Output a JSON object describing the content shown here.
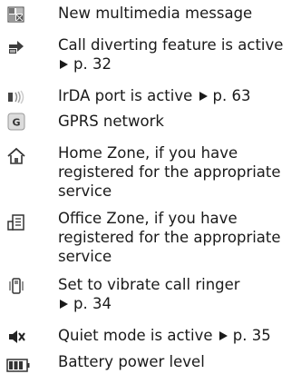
{
  "items": [
    {
      "icon": "multimedia-message-icon",
      "lines": [
        "New multimedia message"
      ]
    },
    {
      "icon": "call-divert-icon",
      "lines": [
        "Call diverting feature is active",
        "p. 32"
      ]
    },
    {
      "icon": "irda-icon",
      "lines": [
        "IrDA port is active",
        "p. 63"
      ]
    },
    {
      "icon": "gprs-icon",
      "icon_glyph": "G",
      "lines": [
        "GPRS network"
      ]
    },
    {
      "icon": "home-zone-icon",
      "lines": [
        "Home Zone, if you have",
        "registered for the appropriate",
        "service"
      ]
    },
    {
      "icon": "office-zone-icon",
      "lines": [
        "Office Zone, if you have",
        "registered for the appropriate",
        "service"
      ]
    },
    {
      "icon": "vibrate-icon",
      "lines": [
        "Set to vibrate call ringer",
        "p. 34"
      ]
    },
    {
      "icon": "quiet-mode-icon",
      "lines": [
        "Quiet mode is active",
        "p. 35"
      ]
    },
    {
      "icon": "battery-icon",
      "lines": [
        "Battery power level"
      ]
    }
  ]
}
